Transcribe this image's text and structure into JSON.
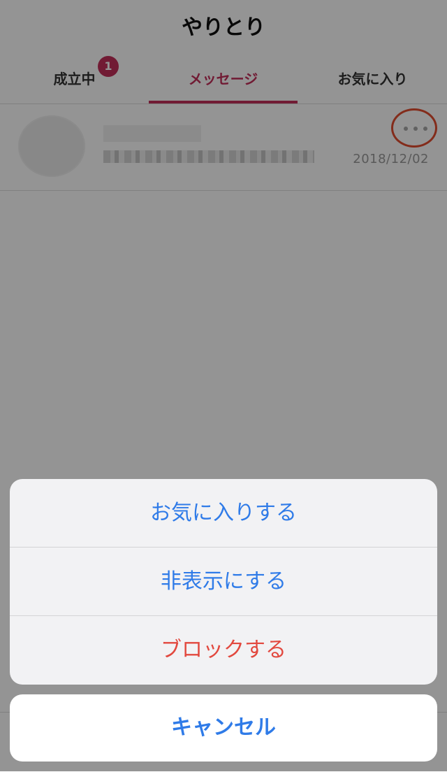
{
  "header": {
    "title": "やりとり"
  },
  "tabs": [
    {
      "label": "成立中"
    },
    {
      "label": "メッセージ"
    },
    {
      "label": "お気に入り"
    }
  ],
  "badge": {
    "count": "1"
  },
  "message_row": {
    "date": "2018/12/02"
  },
  "action_sheet": {
    "items": [
      {
        "label": "お気に入りする"
      },
      {
        "label": "非表示にする"
      },
      {
        "label": "ブロックする"
      }
    ],
    "cancel": "キャンセル"
  },
  "colors": {
    "accent_pink": "#c32f5a",
    "action_blue": "#2f7be8",
    "destructive_red": "#e2483e",
    "highlight_red": "#e24d2f"
  }
}
